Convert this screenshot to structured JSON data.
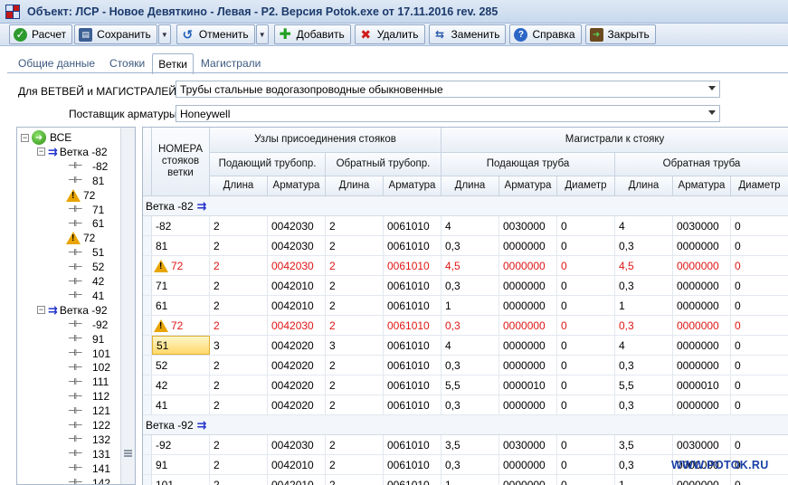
{
  "window": {
    "title": "Объект: ЛСР - Новое Девяткино - Левая - Р2. Версия Potok.exe от 17.11.2016 rev. 285"
  },
  "toolbar": {
    "calc": "Расчет",
    "save": "Сохранить",
    "undo": "Отменить",
    "add": "Добавить",
    "delete": "Удалить",
    "replace": "Заменить",
    "help": "Справка",
    "close": "Закрыть"
  },
  "tabs": [
    "Общие данные",
    "Стояки",
    "Ветки",
    "Магистрали"
  ],
  "form": {
    "branches_label": "Для  ВЕТВЕЙ и МАГИСТРАЛЕЙ :",
    "branches_value": "Трубы стальные водогазопроводные обыкновенные",
    "supplier_label": "Поставщик арматуры",
    "supplier_value": "Honeywell"
  },
  "tree": {
    "root": "ВСЕ",
    "branches": [
      {
        "label": "Ветка -82",
        "items": [
          {
            "label": "-82",
            "warn": false
          },
          {
            "label": "81",
            "warn": false
          },
          {
            "label": "72",
            "warn": true
          },
          {
            "label": "71",
            "warn": false
          },
          {
            "label": "61",
            "warn": false
          },
          {
            "label": "72",
            "warn": true
          },
          {
            "label": "51",
            "warn": false
          },
          {
            "label": "52",
            "warn": false
          },
          {
            "label": "42",
            "warn": false
          },
          {
            "label": "41",
            "warn": false
          }
        ]
      },
      {
        "label": "Ветка -92",
        "items": [
          {
            "label": "-92",
            "warn": false
          },
          {
            "label": "91",
            "warn": false
          },
          {
            "label": "101",
            "warn": false
          },
          {
            "label": "102",
            "warn": false
          },
          {
            "label": "111",
            "warn": false
          },
          {
            "label": "112",
            "warn": false
          },
          {
            "label": "121",
            "warn": false
          },
          {
            "label": "122",
            "warn": false
          },
          {
            "label": "132",
            "warn": false
          },
          {
            "label": "131",
            "warn": false
          },
          {
            "label": "141",
            "warn": false
          },
          {
            "label": "142",
            "warn": false
          }
        ]
      }
    ]
  },
  "grid": {
    "header": {
      "risers": "НОМЕРА стояков ветки",
      "nodes": "Узлы присоединения стояков",
      "mains": "Магистрали к стояку",
      "supply_pipe": "Подающий трубопр.",
      "return_pipe": "Обратный трубопр.",
      "supply_main": "Подающая труба",
      "return_main": "Обратная труба",
      "length": "Длина",
      "fitting": "Арматура",
      "diameter": "Диаметр"
    },
    "groups": [
      {
        "label": "Ветка -82",
        "rows": [
          {
            "n": "-82",
            "warn": false,
            "red": false,
            "sel": false,
            "c": [
              "2",
              "0042030",
              "2",
              "0061010",
              "4",
              "0030000",
              "0",
              "4",
              "0030000",
              "0"
            ]
          },
          {
            "n": "81",
            "warn": false,
            "red": false,
            "sel": false,
            "c": [
              "2",
              "0042030",
              "2",
              "0061010",
              "0,3",
              "0000000",
              "0",
              "0,3",
              "0000000",
              "0"
            ]
          },
          {
            "n": "72",
            "warn": true,
            "red": true,
            "sel": false,
            "c": [
              "2",
              "0042030",
              "2",
              "0061010",
              "4,5",
              "0000000",
              "0",
              "4,5",
              "0000000",
              "0"
            ]
          },
          {
            "n": "71",
            "warn": false,
            "red": false,
            "sel": false,
            "c": [
              "2",
              "0042010",
              "2",
              "0061010",
              "0,3",
              "0000000",
              "0",
              "0,3",
              "0000000",
              "0"
            ]
          },
          {
            "n": "61",
            "warn": false,
            "red": false,
            "sel": false,
            "c": [
              "2",
              "0042010",
              "2",
              "0061010",
              "1",
              "0000000",
              "0",
              "1",
              "0000000",
              "0"
            ]
          },
          {
            "n": "72",
            "warn": true,
            "red": true,
            "sel": false,
            "c": [
              "2",
              "0042030",
              "2",
              "0061010",
              "0,3",
              "0000000",
              "0",
              "0,3",
              "0000000",
              "0"
            ]
          },
          {
            "n": "51",
            "warn": false,
            "red": false,
            "sel": true,
            "c": [
              "3",
              "0042020",
              "3",
              "0061010",
              "4",
              "0000000",
              "0",
              "4",
              "0000000",
              "0"
            ]
          },
          {
            "n": "52",
            "warn": false,
            "red": false,
            "sel": false,
            "c": [
              "2",
              "0042020",
              "2",
              "0061010",
              "0,3",
              "0000000",
              "0",
              "0,3",
              "0000000",
              "0"
            ]
          },
          {
            "n": "42",
            "warn": false,
            "red": false,
            "sel": false,
            "c": [
              "2",
              "0042020",
              "2",
              "0061010",
              "5,5",
              "0000010",
              "0",
              "5,5",
              "0000010",
              "0"
            ]
          },
          {
            "n": "41",
            "warn": false,
            "red": false,
            "sel": false,
            "c": [
              "2",
              "0042020",
              "2",
              "0061010",
              "0,3",
              "0000000",
              "0",
              "0,3",
              "0000000",
              "0"
            ]
          }
        ]
      },
      {
        "label": "Ветка -92",
        "rows": [
          {
            "n": "-92",
            "warn": false,
            "red": false,
            "sel": false,
            "c": [
              "2",
              "0042030",
              "2",
              "0061010",
              "3,5",
              "0030000",
              "0",
              "3,5",
              "0030000",
              "0"
            ]
          },
          {
            "n": "91",
            "warn": false,
            "red": false,
            "sel": false,
            "c": [
              "2",
              "0042010",
              "2",
              "0061010",
              "0,3",
              "0000000",
              "0",
              "0,3",
              "0000000",
              "0"
            ]
          },
          {
            "n": "101",
            "warn": false,
            "red": false,
            "sel": false,
            "c": [
              "2",
              "0042010",
              "2",
              "0061010",
              "1",
              "0000000",
              "0",
              "1",
              "0000000",
              "0"
            ]
          }
        ]
      }
    ]
  },
  "watermark": "WWW.POTOK.RU"
}
